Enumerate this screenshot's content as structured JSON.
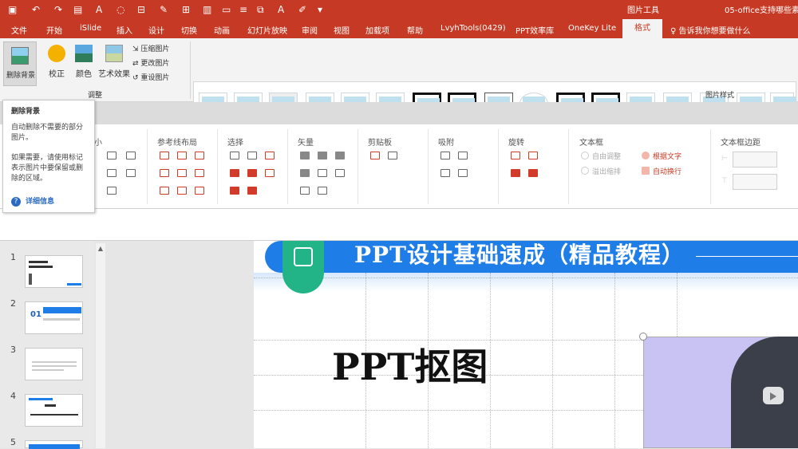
{
  "quick_access": {
    "picture_tools_label": "图片工具",
    "file_title": "05-office支持哪些素"
  },
  "menu": {
    "file": "文件",
    "home": "开始",
    "islide": "iSlide",
    "insert": "插入",
    "design": "设计",
    "transitions": "切换",
    "animations": "动画",
    "slideshow": "幻灯片放映",
    "review": "审阅",
    "view": "视图",
    "addins": "加载项",
    "help": "帮助",
    "lvyhtools": "LvyhTools(0429)",
    "pptlib": "PPT效率库",
    "onekey": "OneKey Lite",
    "format": "格式",
    "tellme": "告诉我你想要做什么"
  },
  "ribbon": {
    "remove_bg": "删除背景",
    "corrections": "校正",
    "color": "颜色",
    "artistic": "艺术效果",
    "compress": "压缩图片",
    "change": "更改图片",
    "reset": "重设图片",
    "adjust_group": "调整",
    "styles_group": "图片样式"
  },
  "panel": {
    "size_partial": "小",
    "guides_layout": "参考线布局",
    "select": "选择",
    "vector": "矢量",
    "clipboard": "剪贴板",
    "snap": "吸附",
    "rotate": "旋转",
    "textbox": "文本框",
    "textbox_margin": "文本框边距",
    "autofit": "自由调整",
    "overflow_shrink": "溢出缩排",
    "shape_text": "根据文字",
    "autowrap": "自动换行"
  },
  "tooltip": {
    "title": "删除背景",
    "line1": "自动删除不需要的部分",
    "line2": "图片。",
    "line3": "如果需要，请使用标记",
    "line4": "表示图片中要保留或删",
    "line5": "除的区域。",
    "more": "详细信息"
  },
  "thumbnails": [
    "1",
    "2",
    "3",
    "4",
    "5"
  ],
  "slide": {
    "banner_title": "PPT设计基础速成（精品教程）",
    "main_title": "PPT抠图"
  },
  "colors": {
    "accent": "#c63a25",
    "banner": "#1e7de6",
    "badge": "#22b486"
  }
}
